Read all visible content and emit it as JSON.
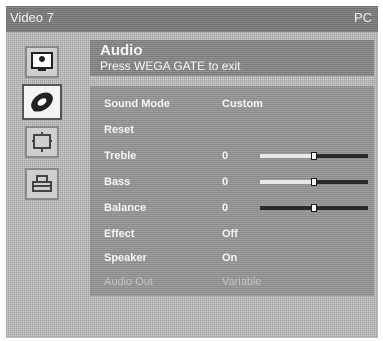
{
  "top_bar": {
    "input": "Video 7",
    "mode": "PC"
  },
  "sidebar": {
    "icons": [
      "picture-icon",
      "audio-icon",
      "screen-icon",
      "setup-icon"
    ],
    "selected": "audio-icon"
  },
  "header": {
    "title": "Audio",
    "subtitle": "Press WEGA GATE to exit"
  },
  "menu": {
    "sound_mode": {
      "label": "Sound Mode",
      "value": "Custom"
    },
    "reset": {
      "label": "Reset"
    },
    "treble": {
      "label": "Treble",
      "value": "0",
      "level_fraction": 0.5
    },
    "bass": {
      "label": "Bass",
      "value": "0",
      "level_fraction": 0.5
    },
    "balance": {
      "label": "Balance",
      "value": "0",
      "level_fraction": 0.5
    },
    "effect": {
      "label": "Effect",
      "value": "Off"
    },
    "speaker": {
      "label": "Speaker",
      "value": "On"
    },
    "audio_out": {
      "label": "Audio Out",
      "value": "Variable",
      "disabled": true
    }
  }
}
